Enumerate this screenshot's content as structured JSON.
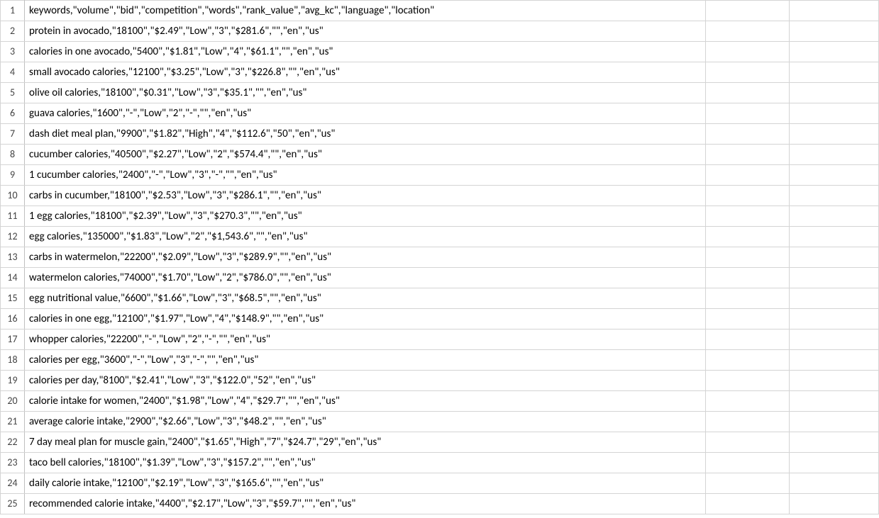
{
  "rows": [
    {
      "num": "1",
      "text": "keywords,\"volume\",\"bid\",\"competition\",\"words\",\"rank_value\",\"avg_kc\",\"language\",\"location\""
    },
    {
      "num": "2",
      "text": "protein in avocado,\"18100\",\"$2.49\",\"Low\",\"3\",\"$281.6\",\"\",\"en\",\"us\""
    },
    {
      "num": "3",
      "text": "calories in one avocado,\"5400\",\"$1.81\",\"Low\",\"4\",\"$61.1\",\"\",\"en\",\"us\""
    },
    {
      "num": "4",
      "text": "small avocado calories,\"12100\",\"$3.25\",\"Low\",\"3\",\"$226.8\",\"\",\"en\",\"us\""
    },
    {
      "num": "5",
      "text": "olive oil calories,\"18100\",\"$0.31\",\"Low\",\"3\",\"$35.1\",\"\",\"en\",\"us\""
    },
    {
      "num": "6",
      "text": "guava calories,\"1600\",\"-\",\"Low\",\"2\",\"-\",\"\",\"en\",\"us\""
    },
    {
      "num": "7",
      "text": "dash diet meal plan,\"9900\",\"$1.82\",\"High\",\"4\",\"$112.6\",\"50\",\"en\",\"us\""
    },
    {
      "num": "8",
      "text": "cucumber calories,\"40500\",\"$2.27\",\"Low\",\"2\",\"$574.4\",\"\",\"en\",\"us\""
    },
    {
      "num": "9",
      "text": "1 cucumber calories,\"2400\",\"-\",\"Low\",\"3\",\"-\",\"\",\"en\",\"us\""
    },
    {
      "num": "10",
      "text": "carbs in cucumber,\"18100\",\"$2.53\",\"Low\",\"3\",\"$286.1\",\"\",\"en\",\"us\""
    },
    {
      "num": "11",
      "text": "1 egg calories,\"18100\",\"$2.39\",\"Low\",\"3\",\"$270.3\",\"\",\"en\",\"us\""
    },
    {
      "num": "12",
      "text": "egg calories,\"135000\",\"$1.83\",\"Low\",\"2\",\"$1,543.6\",\"\",\"en\",\"us\""
    },
    {
      "num": "13",
      "text": "carbs in watermelon,\"22200\",\"$2.09\",\"Low\",\"3\",\"$289.9\",\"\",\"en\",\"us\""
    },
    {
      "num": "14",
      "text": "watermelon calories,\"74000\",\"$1.70\",\"Low\",\"2\",\"$786.0\",\"\",\"en\",\"us\""
    },
    {
      "num": "15",
      "text": "egg nutritional value,\"6600\",\"$1.66\",\"Low\",\"3\",\"$68.5\",\"\",\"en\",\"us\""
    },
    {
      "num": "16",
      "text": "calories in one egg,\"12100\",\"$1.97\",\"Low\",\"4\",\"$148.9\",\"\",\"en\",\"us\""
    },
    {
      "num": "17",
      "text": "whopper calories,\"22200\",\"-\",\"Low\",\"2\",\"-\",\"\",\"en\",\"us\""
    },
    {
      "num": "18",
      "text": "calories per egg,\"3600\",\"-\",\"Low\",\"3\",\"-\",\"\",\"en\",\"us\""
    },
    {
      "num": "19",
      "text": "calories per day,\"8100\",\"$2.41\",\"Low\",\"3\",\"$122.0\",\"52\",\"en\",\"us\""
    },
    {
      "num": "20",
      "text": "calorie intake for women,\"2400\",\"$1.98\",\"Low\",\"4\",\"$29.7\",\"\",\"en\",\"us\""
    },
    {
      "num": "21",
      "text": "average calorie intake,\"2900\",\"$2.66\",\"Low\",\"3\",\"$48.2\",\"\",\"en\",\"us\""
    },
    {
      "num": "22",
      "text": "7 day meal plan for muscle gain,\"2400\",\"$1.65\",\"High\",\"7\",\"$24.7\",\"29\",\"en\",\"us\""
    },
    {
      "num": "23",
      "text": "taco bell calories,\"18100\",\"$1.39\",\"Low\",\"3\",\"$157.2\",\"\",\"en\",\"us\""
    },
    {
      "num": "24",
      "text": "daily calorie intake,\"12100\",\"$2.19\",\"Low\",\"3\",\"$165.6\",\"\",\"en\",\"us\""
    },
    {
      "num": "25",
      "text": "recommended calorie intake,\"4400\",\"$2.17\",\"Low\",\"3\",\"$59.7\",\"\",\"en\",\"us\""
    }
  ]
}
